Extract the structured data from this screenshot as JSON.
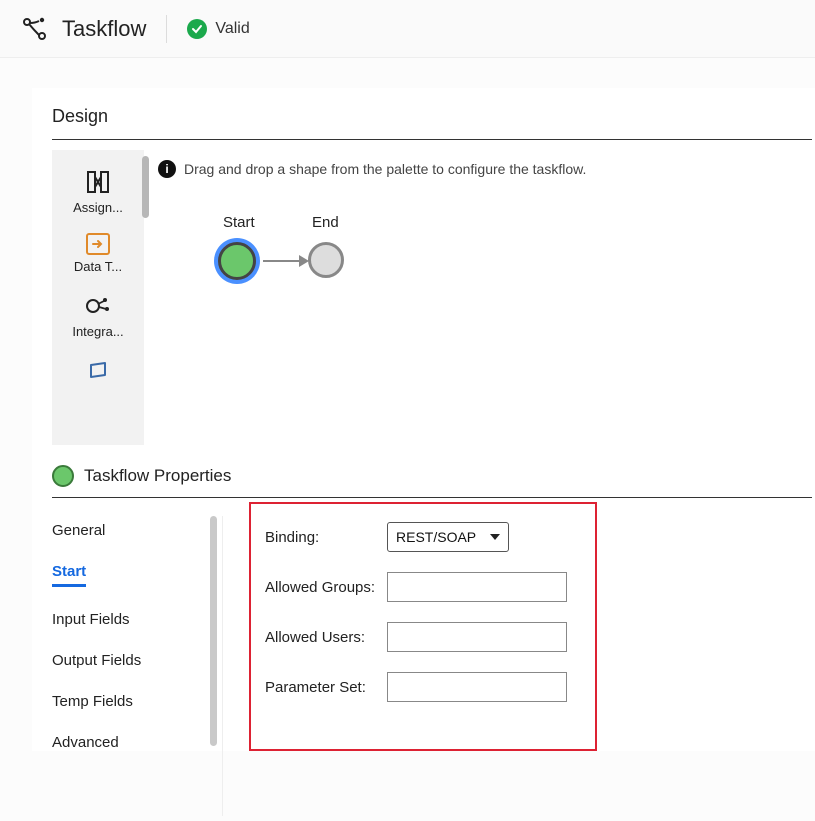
{
  "header": {
    "title": "Taskflow",
    "status_text": "Valid"
  },
  "design": {
    "title": "Design",
    "hint": "Drag and drop a shape from the palette to configure the taskflow.",
    "palette": [
      {
        "label": "Assign..."
      },
      {
        "label": "Data T..."
      },
      {
        "label": "Integra..."
      },
      {
        "label": ""
      }
    ],
    "nodes": {
      "start": "Start",
      "end": "End"
    }
  },
  "properties": {
    "title": "Taskflow Properties",
    "tabs": {
      "general": "General",
      "start": "Start",
      "input_fields": "Input Fields",
      "output_fields": "Output Fields",
      "temp_fields": "Temp Fields",
      "advanced": "Advanced"
    },
    "active_tab": "start",
    "form": {
      "binding_label": "Binding:",
      "binding_value": "REST/SOAP",
      "allowed_groups_label": "Allowed Groups:",
      "allowed_users_label": "Allowed Users:",
      "parameter_set_label": "Parameter Set:"
    }
  }
}
